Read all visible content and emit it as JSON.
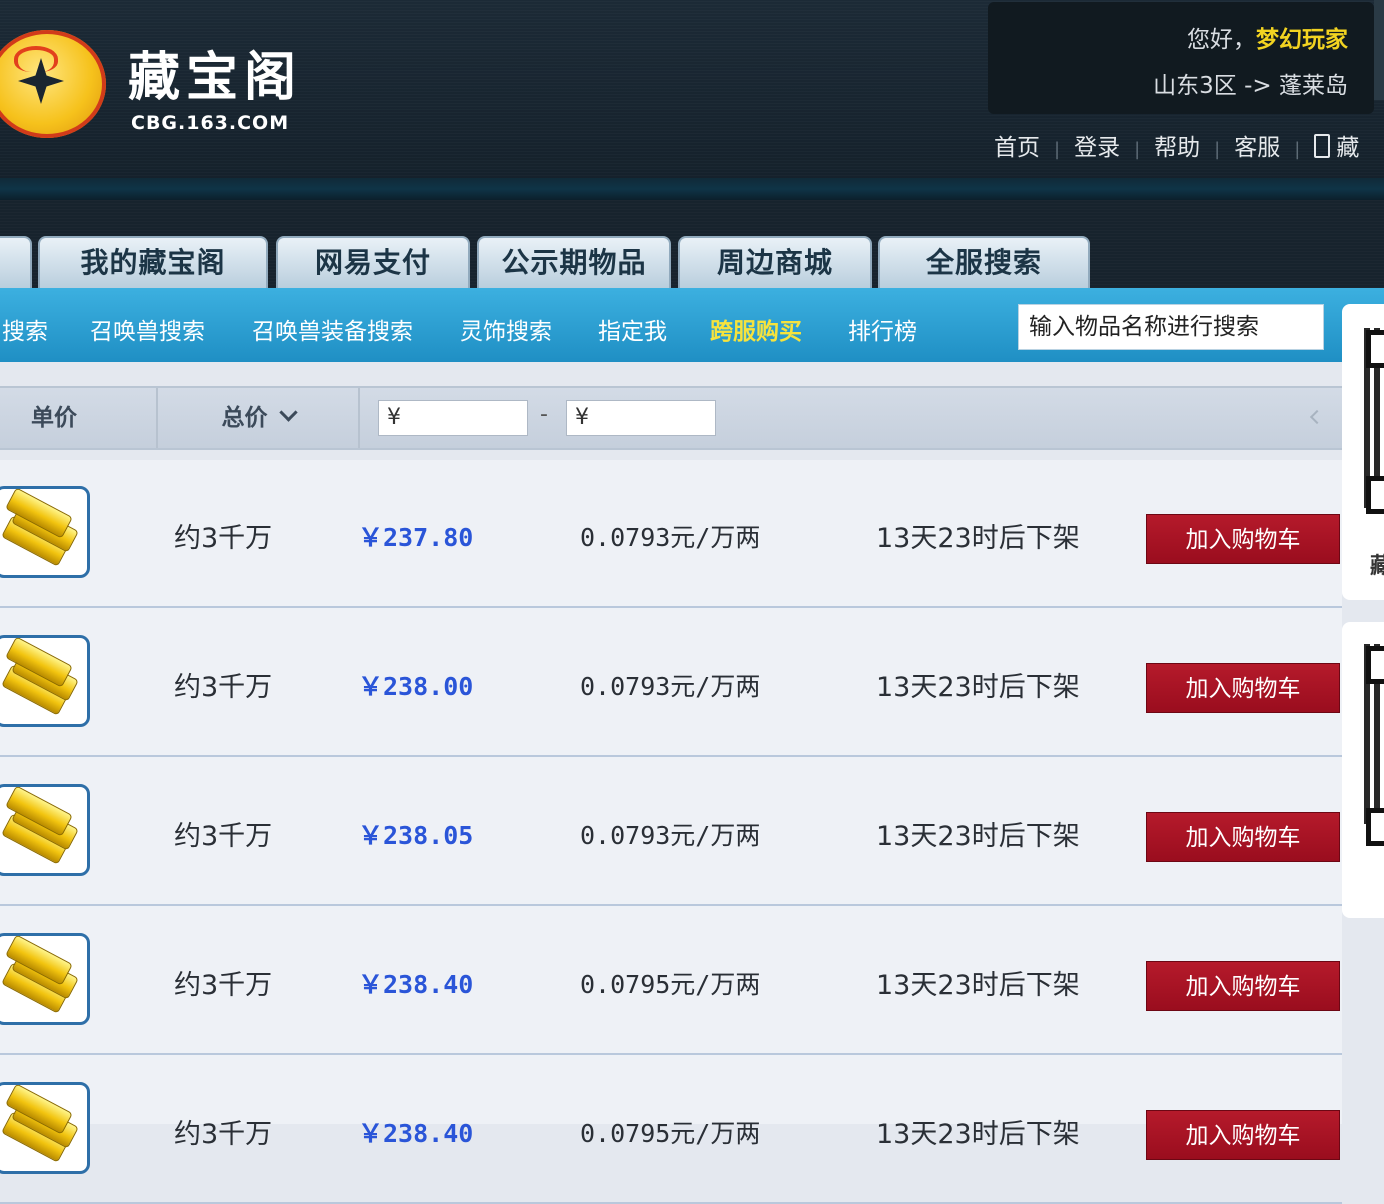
{
  "header": {
    "logo_title": "藏宝阁",
    "logo_sub": "CBG.163.COM",
    "greeting_prefix": "您好，",
    "username": "梦幻玩家",
    "server": "山东3区 -> 蓬莱岛",
    "nav": [
      "首页",
      "登录",
      "帮助",
      "客服",
      "藏"
    ]
  },
  "tabs": [
    "我的藏宝阁",
    "网易支付",
    "公示期物品",
    "周边商城",
    "全服搜索"
  ],
  "subnav": {
    "items": [
      "搜索",
      "召唤兽搜索",
      "召唤兽装备搜索",
      "灵饰搜索",
      "指定我",
      "跨服购买",
      "排行榜"
    ],
    "highlight": "跨服购买",
    "search_placeholder": "输入物品名称进行搜索"
  },
  "filter": {
    "unit_price": "单价",
    "total_price": "总价",
    "min_prefix": "¥",
    "max_prefix": "¥",
    "range_separator": "-"
  },
  "listings": [
    {
      "amount": "约3千万",
      "price": "￥237.80",
      "unit": "0.0793元/万两",
      "time": "13天23时后下架",
      "button": "加入购物车"
    },
    {
      "amount": "约3千万",
      "price": "￥238.00",
      "unit": "0.0793元/万两",
      "time": "13天23时后下架",
      "button": "加入购物车"
    },
    {
      "amount": "约3千万",
      "price": "￥238.05",
      "unit": "0.0793元/万两",
      "time": "13天23时后下架",
      "button": "加入购物车"
    },
    {
      "amount": "约3千万",
      "price": "￥238.40",
      "unit": "0.0795元/万两",
      "time": "13天23时后下架",
      "button": "加入购物车"
    },
    {
      "amount": "约3千万",
      "price": "￥238.40",
      "unit": "0.0795元/万两",
      "time": "13天23时后下架",
      "button": "加入购物车"
    }
  ],
  "side": {
    "qr_caption": "藏"
  },
  "colors": {
    "accent_blue": "#1f8fc4",
    "price_blue": "#2a55d8",
    "button_red": "#9a0d1e",
    "username_yellow": "#f2d321"
  }
}
